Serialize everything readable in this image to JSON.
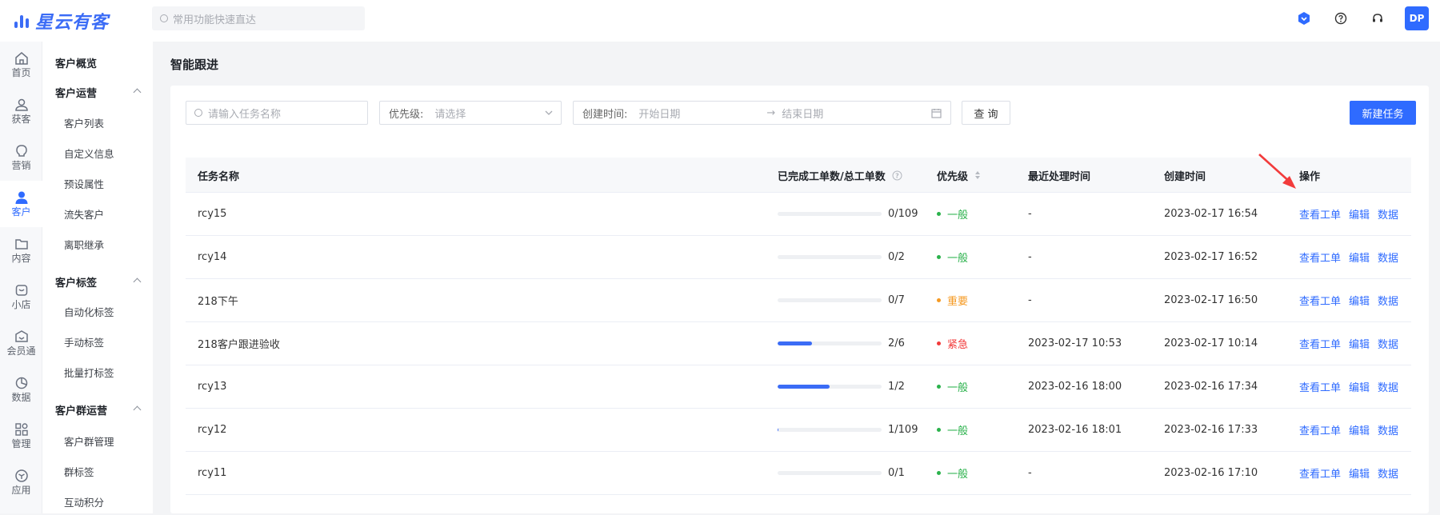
{
  "app": {
    "brand": "星云有客",
    "search_placeholder": "常用功能快速直达",
    "user_initials": "DP",
    "accent": "#2f6bff"
  },
  "rail": [
    {
      "label": "首页",
      "icon": "home-icon"
    },
    {
      "label": "获客",
      "icon": "user-add-icon"
    },
    {
      "label": "营销",
      "icon": "bulb-icon"
    },
    {
      "label": "客户",
      "icon": "customer-icon",
      "active": true
    },
    {
      "label": "内容",
      "icon": "folder-icon"
    },
    {
      "label": "小店",
      "icon": "shop-icon"
    },
    {
      "label": "会员通",
      "icon": "member-icon"
    },
    {
      "label": "数据",
      "icon": "pie-icon"
    },
    {
      "label": "管理",
      "icon": "grid-icon"
    },
    {
      "label": "应用",
      "icon": "cube-icon"
    }
  ],
  "submenu": [
    {
      "label": "客户概览",
      "type": "group"
    },
    {
      "label": "客户运营",
      "type": "group",
      "expandable": true
    },
    {
      "label": "客户列表",
      "type": "sub"
    },
    {
      "label": "自定义信息",
      "type": "sub"
    },
    {
      "label": "预设属性",
      "type": "sub"
    },
    {
      "label": "流失客户",
      "type": "sub"
    },
    {
      "label": "离职继承",
      "type": "sub"
    },
    {
      "label": "客户标签",
      "type": "group",
      "expandable": true
    },
    {
      "label": "自动化标签",
      "type": "sub"
    },
    {
      "label": "手动标签",
      "type": "sub"
    },
    {
      "label": "批量打标签",
      "type": "sub"
    },
    {
      "label": "客户群运营",
      "type": "group",
      "expandable": true
    },
    {
      "label": "客户群管理",
      "type": "sub"
    },
    {
      "label": "群标签",
      "type": "sub"
    },
    {
      "label": "互动积分",
      "type": "sub"
    }
  ],
  "page": {
    "title": "智能跟进"
  },
  "filters": {
    "task_placeholder": "请输入任务名称",
    "priority_label": "优先级:",
    "priority_placeholder": "请选择",
    "created_label": "创建时间:",
    "start_placeholder": "开始日期",
    "end_placeholder": "结束日期",
    "query_label": "查 询",
    "new_task_label": "新建任务"
  },
  "table": {
    "columns": [
      "任务名称",
      "已完成工单数/总工单数",
      "优先级",
      "最近处理时间",
      "创建时间",
      "操作"
    ],
    "actions": [
      "查看工单",
      "编辑",
      "数据"
    ],
    "priority_colors": {
      "一般": "#2bb24c",
      "重要": "#f59a23",
      "紧急": "#f23b3b"
    },
    "rows": [
      {
        "name": "rcy15",
        "done": 0,
        "total": 109,
        "ratio": "0/109",
        "priority": "一般",
        "last": "-",
        "created": "2023-02-17 16:54"
      },
      {
        "name": "rcy14",
        "done": 0,
        "total": 2,
        "ratio": "0/2",
        "priority": "一般",
        "last": "-",
        "created": "2023-02-17 16:52"
      },
      {
        "name": "218下午",
        "done": 0,
        "total": 7,
        "ratio": "0/7",
        "priority": "重要",
        "last": "-",
        "created": "2023-02-17 16:50"
      },
      {
        "name": "218客户跟进验收",
        "done": 2,
        "total": 6,
        "ratio": "2/6",
        "priority": "紧急",
        "last": "2023-02-17 10:53",
        "created": "2023-02-17 10:14"
      },
      {
        "name": "rcy13",
        "done": 1,
        "total": 2,
        "ratio": "1/2",
        "priority": "一般",
        "last": "2023-02-16 18:00",
        "created": "2023-02-16 17:34"
      },
      {
        "name": "rcy12",
        "done": 1,
        "total": 109,
        "ratio": "1/109",
        "priority": "一般",
        "last": "2023-02-16 18:01",
        "created": "2023-02-16 17:33"
      },
      {
        "name": "rcy11",
        "done": 0,
        "total": 1,
        "ratio": "0/1",
        "priority": "一般",
        "last": "-",
        "created": "2023-02-16 17:10"
      }
    ]
  }
}
